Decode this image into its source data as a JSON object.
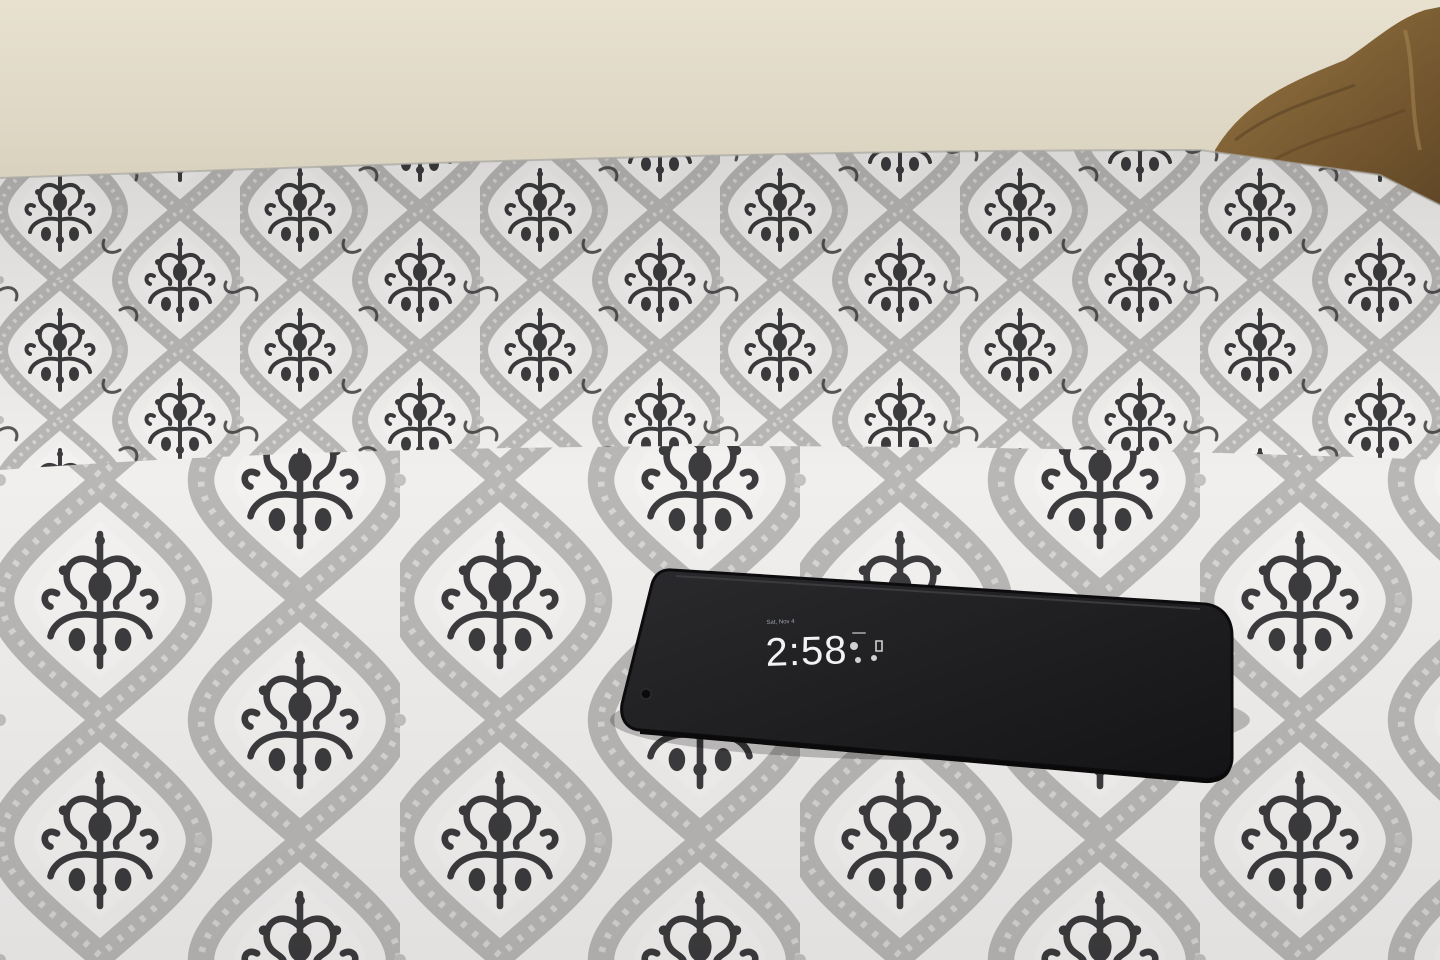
{
  "scene": {
    "subject": "smartphone",
    "colors": {
      "wall": "#e2dccb",
      "sheet_base": "#f1efee",
      "damask_dark": "#3c3c3e",
      "damask_band": "#b9b7b5",
      "pillow": "#8a6a3c",
      "phone_body": "#1d1d1f"
    }
  },
  "phone_screen": {
    "time": "2:58",
    "date": "Sat, Nov 4"
  }
}
